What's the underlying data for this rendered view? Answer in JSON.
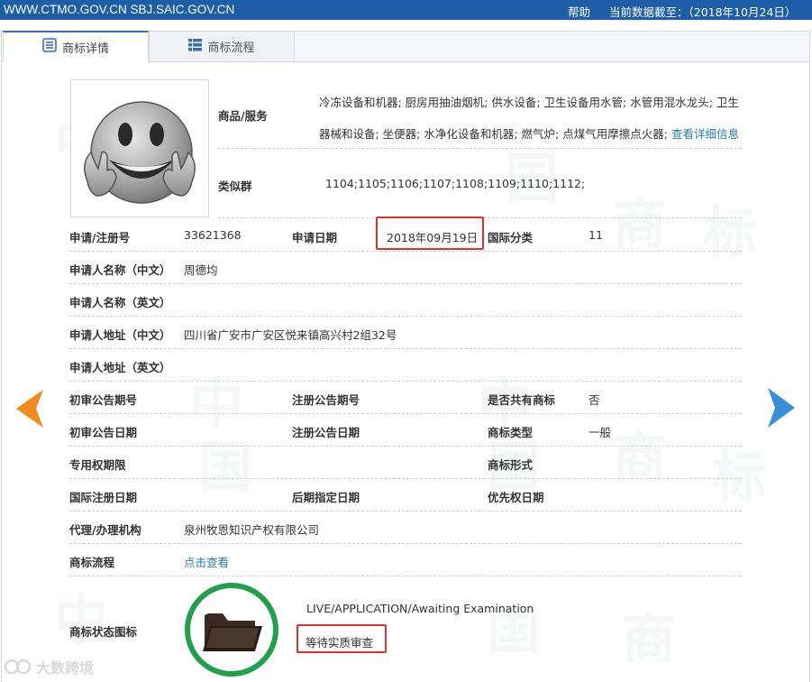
{
  "topbar": {
    "site": "WWW.CTMO.GOV.CN SBJ.SAIC.GOV.CN",
    "help": "帮助",
    "data_as_of": "当前数据截至：（2018年10月24日）"
  },
  "tabs": [
    {
      "label": "商标详情",
      "icon": "list-icon",
      "active": true
    },
    {
      "label": "商标流程",
      "icon": "grid-icon",
      "active": false
    }
  ],
  "watermark": [
    "中",
    "国",
    "商",
    "标"
  ],
  "detail": {
    "goods_label": "商品/服务",
    "goods_text": "冷冻设备和机器; 厨房用抽油烟机; 供水设备; 卫生设备用水管; 水管用混水龙头; 卫生器械和设备; 坐便器; 水净化设备和机器; 燃气炉; 点煤气用摩擦点火器;",
    "goods_more": "查看详细信息",
    "similar_label": "类似群",
    "similar_value": "1104;1105;1106;1107;1108;1109;1110;1112;",
    "reg_no_label": "申请/注册号",
    "reg_no": "33621368",
    "apply_date_label": "申请日期",
    "apply_date": "2018年09月19日",
    "intl_class_label": "国际分类",
    "intl_class": "11",
    "applicant_cn_label": "申请人名称（中文）",
    "applicant_cn": "周德均",
    "applicant_en_label": "申请人名称（英文）",
    "address_cn_label": "申请人地址（中文）",
    "address_cn": "四川省广安市广安区悦来镇高兴村2组32号",
    "address_en_label": "申请人地址（英文）",
    "prelim_no_label": "初审公告期号",
    "reg_pub_no_label": "注册公告期号",
    "shared_label": "是否共有商标",
    "shared": "否",
    "prelim_date_label": "初审公告日期",
    "reg_pub_date_label": "注册公告日期",
    "mark_type_label": "商标类型",
    "mark_type": "一般",
    "exclusive_label": "专用权期限",
    "mark_form_label": "商标形式",
    "intl_reg_date_label": "国际注册日期",
    "later_date_label": "后期指定日期",
    "priority_date_label": "优先权日期",
    "agency_label": "代理/办理机构",
    "agency": "泉州牧恩知识产权有限公司",
    "flow_label": "商标流程",
    "flow_link": "点击查看",
    "status_icon_label": "商标状态图标",
    "status_en": "LIVE/APPLICATION/Awaiting Examination",
    "status_cn": "等待实质审查"
  },
  "brandmark": "大数跨境",
  "colors": {
    "topbar": "#1e5ea8",
    "link": "#2a7ab8",
    "highlight_box": "#d9332a",
    "status_ring": "#20a049",
    "arrow_left": "#f08a1c",
    "arrow_right": "#3b8fd6"
  }
}
